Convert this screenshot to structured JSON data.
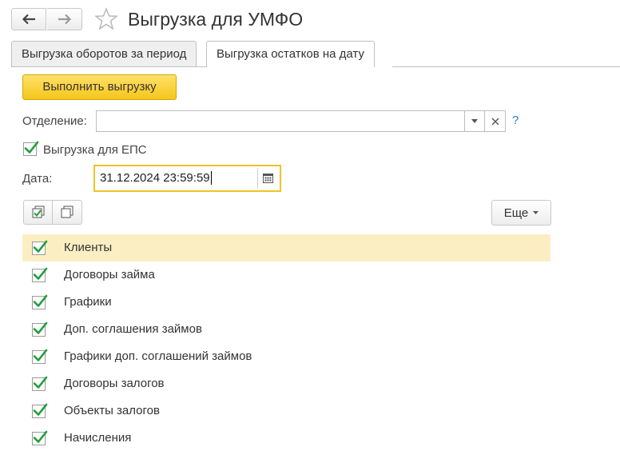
{
  "window": {
    "title": "Выгрузка для УМФО"
  },
  "tabs": [
    {
      "label": "Выгрузка оборотов за период",
      "active": false
    },
    {
      "label": "Выгрузка остатков на дату",
      "active": true
    }
  ],
  "run_button": {
    "label": "Выполнить выгрузку"
  },
  "department": {
    "label": "Отделение:",
    "value": "",
    "help": "?"
  },
  "eps_checkbox": {
    "label": "Выгрузка для ЕПС",
    "checked": true
  },
  "date": {
    "label": "Дата:",
    "value": "31.12.2024 23:59:59"
  },
  "toolbar": {
    "more_label": "Еще"
  },
  "list": {
    "items": [
      {
        "label": "Клиенты",
        "checked": true
      },
      {
        "label": "Договоры займа",
        "checked": true
      },
      {
        "label": "Графики",
        "checked": true
      },
      {
        "label": "Доп. соглашения займов",
        "checked": true
      },
      {
        "label": "Графики доп. соглашений займов",
        "checked": true
      },
      {
        "label": "Договоры залогов",
        "checked": true
      },
      {
        "label": "Объекты залогов",
        "checked": true
      },
      {
        "label": "Начисления",
        "checked": true
      }
    ]
  },
  "colors": {
    "accent_yellow": "#f5c61a",
    "selected_row": "#fbeec3",
    "check_green": "#1f9e3a",
    "help_blue": "#1e7fc8"
  }
}
